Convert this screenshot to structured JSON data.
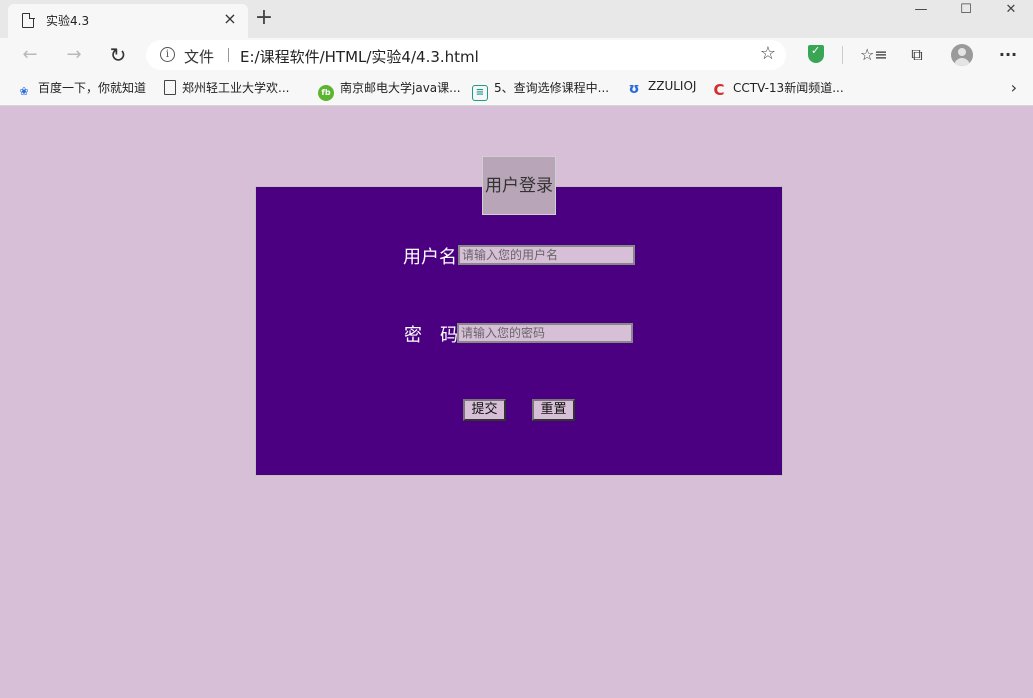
{
  "browser": {
    "tab_title": "实验4.3",
    "tab_close": "×",
    "new_tab": "+",
    "window": {
      "minimize": "—",
      "maximize": "☐",
      "close": "✕"
    },
    "address": {
      "info_glyph": "i",
      "label": "文件",
      "url": "E:/课程软件/HTML/实验4/4.3.html",
      "star": "☆"
    },
    "nav": {
      "back": "←",
      "forward": "→",
      "reload": "↻"
    },
    "toolbar_icons": {
      "favorites": "☆≡",
      "collections": "⧉",
      "more": "···"
    },
    "bookmarks": [
      {
        "label": "百度一下，你就知道",
        "icon": "paw-icon",
        "color": "#2a6be0"
      },
      {
        "label": "郑州轻工业大学欢...",
        "icon": "page-icon",
        "color": "#444444"
      },
      {
        "label": "南京邮电大学java课...",
        "icon": "leaf-icon",
        "color": "#5cb531"
      },
      {
        "label": "5、查询选修课程中...",
        "icon": "book-icon",
        "color": "#1d9a8a"
      },
      {
        "label": "ZZULIOJ",
        "icon": "drop-icon",
        "color": "#2a6be0"
      },
      {
        "label": "CCTV-13新闻频道...",
        "icon": "cctv-icon",
        "color": "#d62b2b"
      }
    ],
    "bookmarks_more": "›"
  },
  "page": {
    "background": "#d8bfd8",
    "panel_color": "#4b0082",
    "legend": "用户登录",
    "username_label": "用户名",
    "username_placeholder": "请输入您的用户名",
    "password_label": "密　码",
    "password_placeholder": "请输入您的密码",
    "submit_label": "提交",
    "reset_label": "重置"
  }
}
